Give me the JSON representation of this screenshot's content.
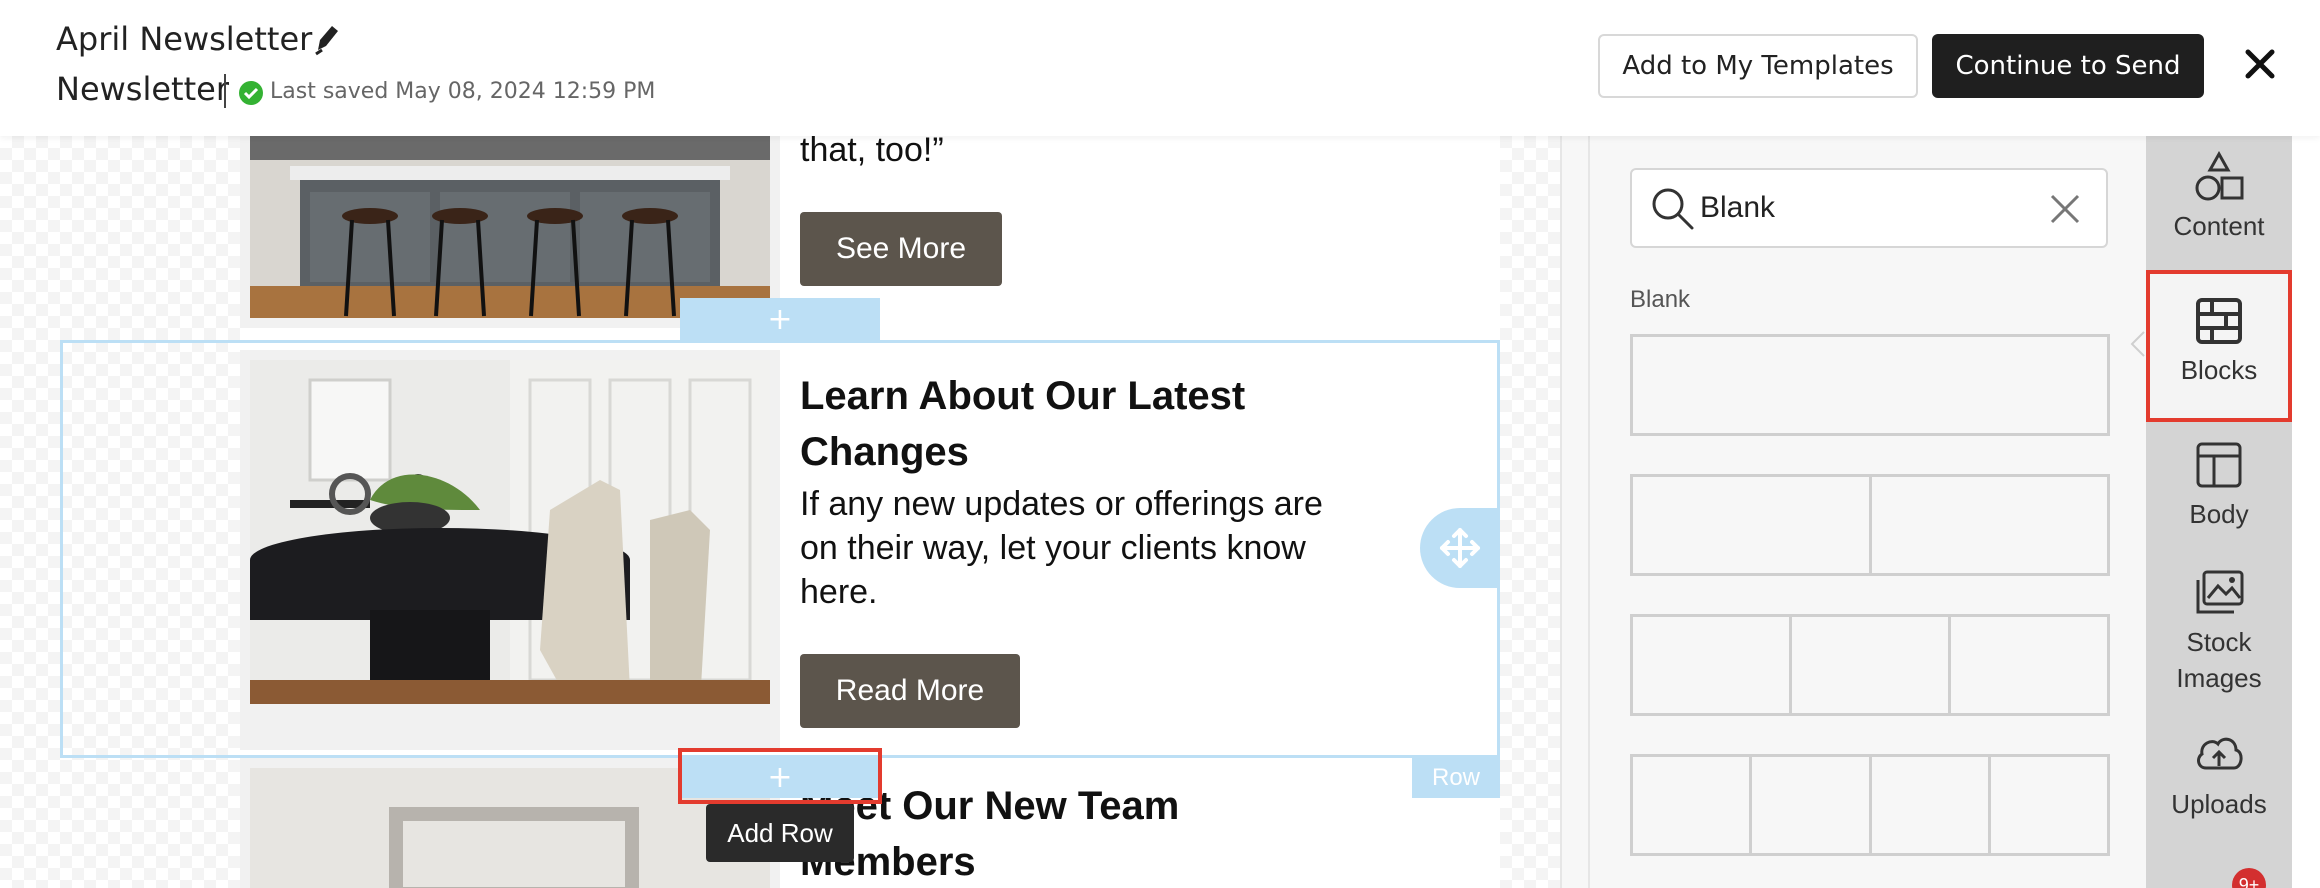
{
  "header": {
    "title": "April Newsletter",
    "doc_type": "Newsletter",
    "saved_status": "Last saved May 08, 2024 12:59 PM",
    "add_template_label": "Add to My Templates",
    "continue_label": "Continue to Send"
  },
  "email": {
    "row1": {
      "body_tail": "that, too!”",
      "button": "See More"
    },
    "row2": {
      "heading": "Learn About Our Latest Changes",
      "body": "If any new updates or offerings are on their way, let your clients know here.",
      "button": "Read More"
    },
    "row3": {
      "heading": "Meet Our New Team Members"
    },
    "row_label": "Row",
    "add_row_tooltip": "Add Row"
  },
  "panel": {
    "search_value": "Blank",
    "section_label": "Blank",
    "blocks": [
      {
        "columns": 1
      },
      {
        "columns": 2
      },
      {
        "columns": 3
      },
      {
        "columns": 4
      }
    ]
  },
  "side_nav": {
    "items": [
      {
        "label": "Content",
        "icon": "shapes-icon"
      },
      {
        "label": "Blocks",
        "icon": "blocks-icon",
        "active": true
      },
      {
        "label": "Body",
        "icon": "layout-icon"
      },
      {
        "label": "Stock Images",
        "icon": "images-icon"
      },
      {
        "label": "Uploads",
        "icon": "cloud-upload-icon"
      }
    ],
    "badge": "9+"
  },
  "colors": {
    "accent_dark": "#1f1f1f",
    "cta_brown": "#5c554c",
    "selection_blue": "#bcdff5",
    "highlight_red": "#e33b2e"
  }
}
